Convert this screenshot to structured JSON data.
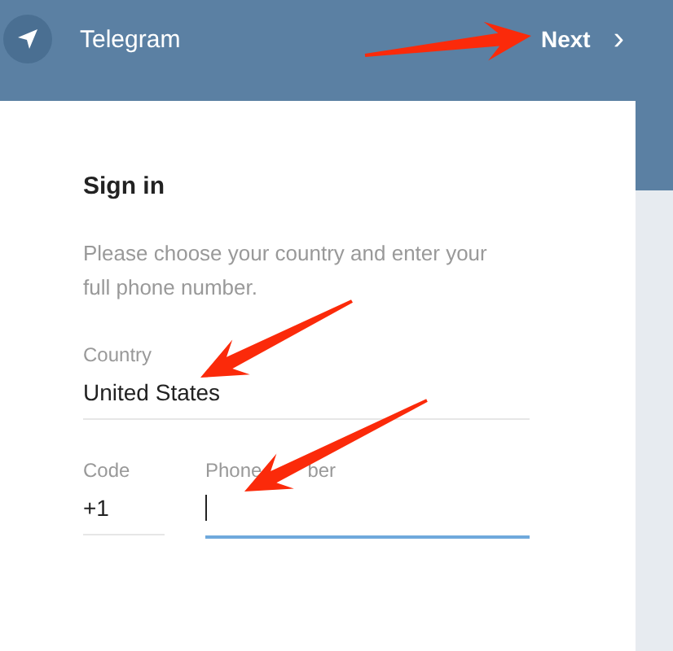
{
  "header": {
    "title": "Telegram",
    "next_button": "Next",
    "next_icon": "›"
  },
  "card": {
    "title": "Sign in",
    "description": "Please choose your country and enter your full phone number.",
    "country": {
      "label": "Country",
      "value": "United States"
    },
    "code": {
      "label": "Code",
      "value": "+1"
    },
    "phone": {
      "label_parts": [
        "Phone",
        "ber"
      ],
      "focused": true
    }
  }
}
